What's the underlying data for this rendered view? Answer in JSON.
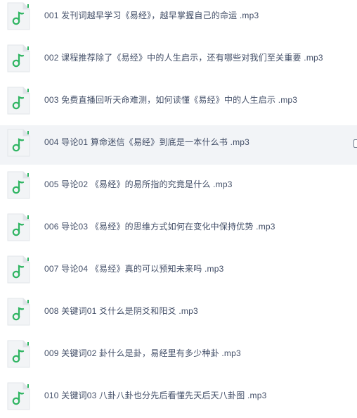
{
  "file_list": {
    "items": [
      {
        "index": "001",
        "name": "001  发刊词越早学习《易经》，越早掌握自己的命运 .mp3",
        "icon": "music-file-icon",
        "hovered": false
      },
      {
        "index": "002",
        "name": "002  课程推荐除了《易经》中的人生启示，还有哪些对我们至关重要 .mp3",
        "icon": "music-file-icon",
        "hovered": false
      },
      {
        "index": "003",
        "name": "003  免费直播回听天命难测，如何读懂《易经》中的人生启示 .mp3",
        "icon": "music-file-icon",
        "hovered": false
      },
      {
        "index": "004",
        "name": "004  导论01  算命迷信《易经》到底是一本什么书 .mp3",
        "icon": "music-file-icon",
        "hovered": true
      },
      {
        "index": "005",
        "name": "005  导论02 《易经》的易所指的究竟是什么 .mp3",
        "icon": "music-file-icon",
        "hovered": false
      },
      {
        "index": "006",
        "name": "006  导论03 《易经》的思维方式如何在变化中保持优势 .mp3",
        "icon": "music-file-icon",
        "hovered": false
      },
      {
        "index": "007",
        "name": "007  导论04 《易经》真的可以预知未来吗 .mp3",
        "icon": "music-file-icon",
        "hovered": false
      },
      {
        "index": "008",
        "name": "008  关键词01  爻什么是阴爻和阳爻 .mp3",
        "icon": "music-file-icon",
        "hovered": false
      },
      {
        "index": "009",
        "name": "009  关键词02  卦什么是卦，易经里有多少种卦 .mp3",
        "icon": "music-file-icon",
        "hovered": false
      },
      {
        "index": "010",
        "name": "010  关键词03  八卦八卦也分先后看懂先天后天八卦图 .mp3",
        "icon": "music-file-icon",
        "hovered": false
      }
    ]
  },
  "colors": {
    "icon_bg": "#f2f4f6",
    "icon_border": "#e2e6ea",
    "icon_fold": "#dfe3e8",
    "icon_note": "#2fb562",
    "text": "#424e67",
    "hover_bg": "#f2f4f7"
  }
}
